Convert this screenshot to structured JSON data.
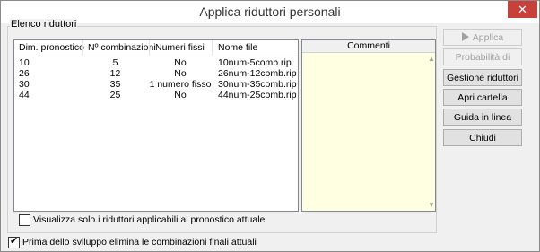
{
  "window": {
    "title": "Applica riduttori personali",
    "close_glyph": "✕"
  },
  "group": {
    "label": "Elenco riduttori"
  },
  "list": {
    "columns": [
      "Dim. pronostico",
      "Nº combinazioni",
      "Numeri fissi",
      "Nome file"
    ],
    "rows": [
      [
        "10",
        "5",
        "No",
        "10num-5comb.rip"
      ],
      [
        "26",
        "12",
        "No",
        "26num-12comb.rip"
      ],
      [
        "30",
        "35",
        "1 numero fisso",
        "30num-35comb.rip"
      ],
      [
        "44",
        "25",
        "No",
        "44num-25comb.rip"
      ]
    ]
  },
  "comments": {
    "header": "Commenti",
    "scroll_up": "▲",
    "scroll_down": "▼"
  },
  "buttons": {
    "apply": "Applica riduttore",
    "probability": "Probabilità di vincita",
    "manage": "Gestione riduttori",
    "open_folder": "Apri cartella riduttori",
    "help": "Guida in linea",
    "close": "Chiudi"
  },
  "options": {
    "only_applicable": {
      "label": "Visualizza solo i riduttori applicabili al pronostico attuale",
      "checked": false
    },
    "remove_final": {
      "label": "Prima dello sviluppo elimina le combinazioni finali attuali",
      "checked": true
    }
  }
}
